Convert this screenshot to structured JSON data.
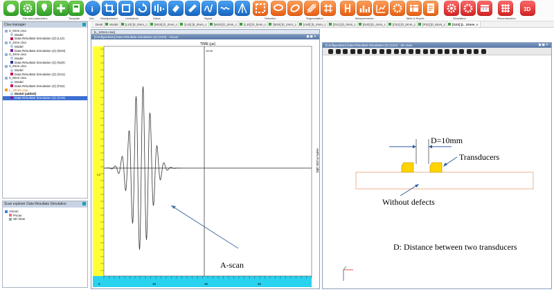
{
  "toolbar": {
    "labels": {
      "file": "File and parameters",
      "template": "Template",
      "info": "Info",
      "readjustment": "Readjustment",
      "limitations": "Limitations",
      "gates": "Gates",
      "signal": "Signal",
      "selection": "Selection",
      "segmentation": "Segmentation",
      "measurements": "Measurements",
      "table": "Table & Report",
      "simulation": "Simulation",
      "reconstruction": "Reconstruction"
    },
    "icon_3d": "3D"
  },
  "doc_tabs": {
    "desk": "Desk",
    "model": "Model",
    "tabs": [
      "[L10] [0_0mm_c",
      "[M19] [0_2mm_c",
      "[L10] [0_0mm_c",
      "[M19] [0_2mm_c",
      "[L10] [0_0mm_c",
      "[M19] [0_2mm_c",
      "[A20] [0_4mm_c",
      "[O21] [0_0mm_c",
      "[N20] [0_4mm_c",
      "[O21] [0_0mm_c",
      "[P22] [0_6mm_c"
    ],
    "active": "[G23] [L_10mm_c"
  },
  "civa_manager": {
    "title": "Civa manager",
    "tree": [
      {
        "text": "0_0mm.civa",
        "level": 0,
        "kind": "file"
      },
      {
        "text": "Model",
        "level": 1,
        "kind": "model"
      },
      {
        "text": "Data Résultats Simulation (Z) (L10)",
        "level": 1,
        "kind": "data",
        "color": "#c2185b"
      },
      {
        "text": "0_2mm.civa",
        "level": 0,
        "kind": "file"
      },
      {
        "text": "Model",
        "level": 1,
        "kind": "model"
      },
      {
        "text": "Data Résultats Simulation (Z) (M19)",
        "level": 1,
        "kind": "data",
        "color": "#7b1fa2"
      },
      {
        "text": "0_4mm.civa",
        "level": 0,
        "kind": "file"
      },
      {
        "text": "Model",
        "level": 1,
        "kind": "model"
      },
      {
        "text": "Data Résultats Simulation (Z) (N20)",
        "level": 1,
        "kind": "data",
        "color": "#283593"
      },
      {
        "text": "0_6mm.civa",
        "level": 0,
        "kind": "file"
      },
      {
        "text": "Model",
        "level": 1,
        "kind": "model"
      },
      {
        "text": "Data Résultats Simulation (Z) (O21)",
        "level": 1,
        "kind": "data",
        "color": "#c2185b"
      },
      {
        "text": "0_8mm.civa",
        "level": 0,
        "kind": "file"
      },
      {
        "text": "Model",
        "level": 1,
        "kind": "model"
      },
      {
        "text": "Data Résultats Simulation (Z) (P22)",
        "level": 1,
        "kind": "data",
        "color": "#c2185b"
      },
      {
        "text": "L_10mm.civa",
        "level": 0,
        "kind": "file",
        "highlight": true
      },
      {
        "text": "Model (added)",
        "level": 1,
        "kind": "model",
        "bold": true
      },
      {
        "text": "Data Résultats Simulation (Z) (G23)",
        "level": 1,
        "kind": "data",
        "color": "#7b1fa2",
        "selected": true
      }
    ]
  },
  "scan_explorer": {
    "title": "Scan explorer Data Résultats Simulation",
    "items": [
      "AScan",
      "Pscan",
      "3D View"
    ]
  },
  "ascan_window": {
    "title": "[Configuration] Data Résultats Simulation (Z) (G23) - AScan",
    "tab": "[L_10mm.civa]",
    "x_axis_title": "TIME (µs)",
    "x_ticks": [
      "0",
      "10",
      "20",
      "30"
    ],
    "y_axis_title": "AMPLITUDE (dB)",
    "cursor_value": "19.00",
    "zero_label": "0.0"
  },
  "view3d_window": {
    "title": "[Configuration] Data Résultats Simulation (Z) (G23) - 3D View"
  },
  "annotations": {
    "distance": "D=10mm",
    "transducers": "Transducers",
    "without_defects": "Without defects",
    "ascan_label": "A-scan",
    "legend": "D: Distance between two transducers"
  },
  "colors": {
    "toolbar_green": "#2e9e25",
    "toolbar_blue": "#1565c0",
    "toolbar_orange": "#e85d10",
    "yellow_axis": "#ffff33",
    "cyan_axis": "#29d3f0",
    "probe": "#ffd400"
  }
}
